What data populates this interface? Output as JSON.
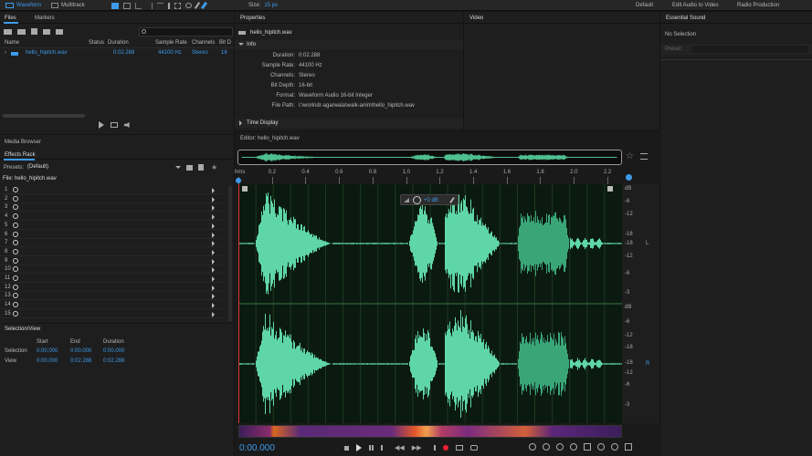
{
  "colors": {
    "accent": "#3d9bea",
    "waveform": "#5fd6a6",
    "waveform_dark": "#2e8e62",
    "background": "#141414",
    "panel": "#1e1e1e"
  },
  "toolbar": {
    "waveform_label": "Waveform",
    "multitrack_label": "Multitrack",
    "size_label": "Size:",
    "size_value": "15 px",
    "workspaces": [
      "Default",
      "Edit Audio to Video",
      "Radio Production"
    ]
  },
  "files_panel": {
    "tabs": [
      "Files",
      "Markers"
    ],
    "search_placeholder": "",
    "columns": [
      "Name",
      "Status",
      "Duration",
      "Sample Rate",
      "Channels",
      "Bit D"
    ],
    "rows": [
      {
        "name": "hello_hipitch.wav",
        "status": "",
        "duration": "0:02.288",
        "sample_rate": "44100 Hz",
        "channels": "Stereo",
        "bit_depth": "16"
      }
    ]
  },
  "media_browser": {
    "title": "Media Browser"
  },
  "effects_rack": {
    "title": "Effects Rack",
    "presets_label": "Presets:",
    "preset_value": "(Default)",
    "file_label": "File: hello_hipitch.wav",
    "slots": [
      "1",
      "2",
      "3",
      "4",
      "5",
      "6",
      "7",
      "8",
      "9",
      "10",
      "11",
      "12",
      "13",
      "14",
      "15"
    ]
  },
  "selection_view": {
    "title": "Selection/View",
    "columns": [
      "Start",
      "End",
      "Duration"
    ],
    "rows": [
      {
        "label": "Selection",
        "start": "0:00.000",
        "end": "0:00.000",
        "duration": "0:00.000"
      },
      {
        "label": "View",
        "start": "0:00.000",
        "end": "0:02.288",
        "duration": "0:02.288"
      }
    ]
  },
  "properties": {
    "title": "Properties",
    "file_name": "hello_hipitch.wav",
    "info_label": "Info",
    "info": [
      {
        "key": "Duration:",
        "value": "0:02.288"
      },
      {
        "key": "Sample Rate:",
        "value": "44100 Hz"
      },
      {
        "key": "Channels:",
        "value": "Stereo"
      },
      {
        "key": "Bit Depth:",
        "value": "16-bit"
      },
      {
        "key": "Format:",
        "value": "Waveform Audio 16-bit Integer"
      },
      {
        "key": "File Path:",
        "value": "I:\\work\\dr-agarwala\\walk-anim\\hello_hipitch.wav"
      }
    ],
    "time_display_label": "Time Display"
  },
  "video": {
    "title": "Video"
  },
  "essential_sound": {
    "title": "Essential Sound",
    "selection": "No Selection",
    "preset_label": "Preset:"
  },
  "editor": {
    "title": "Editor: hello_hipitch.wav",
    "ruler": [
      "hms",
      "0.2",
      "0.4",
      "0.6",
      "0.8",
      "1.0",
      "1.2",
      "1.4",
      "1.6",
      "1.8",
      "2.0",
      "2.2"
    ],
    "hud_gain": "+0 dB",
    "db_scale_top": [
      "dB",
      "-6",
      "-12",
      "-18",
      "-18",
      "-12",
      "-6"
    ],
    "db_scale_bottom": [
      "-3",
      "dB",
      "-6",
      "-12",
      "-18",
      "-18",
      "-12",
      "-6",
      "-3"
    ],
    "channel_left": "L",
    "channel_right": "R",
    "time": "0:00.000"
  }
}
